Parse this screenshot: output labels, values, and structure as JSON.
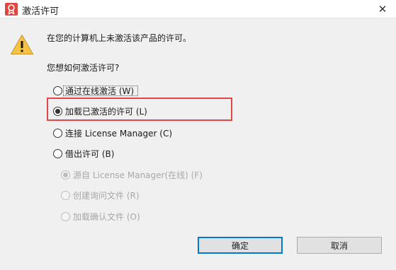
{
  "window": {
    "title": "激活许可",
    "close_glyph": "✕",
    "app_icon": "autodesk-license-icon"
  },
  "dialog": {
    "warning_icon": "warning-triangle-icon",
    "message": "在您的计算机上未激活该产品的许可。",
    "question": "您想如何激活许可?"
  },
  "options": [
    {
      "label": "通过在线激活 (W)",
      "selected": false,
      "enabled": true
    },
    {
      "label": "加载已激活的许可 (L)",
      "selected": true,
      "enabled": true
    },
    {
      "label": "连接 License Manager (C)",
      "selected": false,
      "enabled": true
    },
    {
      "label": "借出许可 (B)",
      "selected": false,
      "enabled": true
    }
  ],
  "sub_options": [
    {
      "label": "源自 License Manager(在线) (F)",
      "selected": true,
      "enabled": false
    },
    {
      "label": "创建询问文件 (R)",
      "selected": false,
      "enabled": false
    },
    {
      "label": "加载确认文件 (O)",
      "selected": false,
      "enabled": false
    }
  ],
  "buttons": {
    "ok": "确定",
    "cancel": "取消"
  },
  "colors": {
    "highlight_border": "#e04848",
    "warning_fill": "#f5c242",
    "default_button_border": "#0078d7"
  }
}
